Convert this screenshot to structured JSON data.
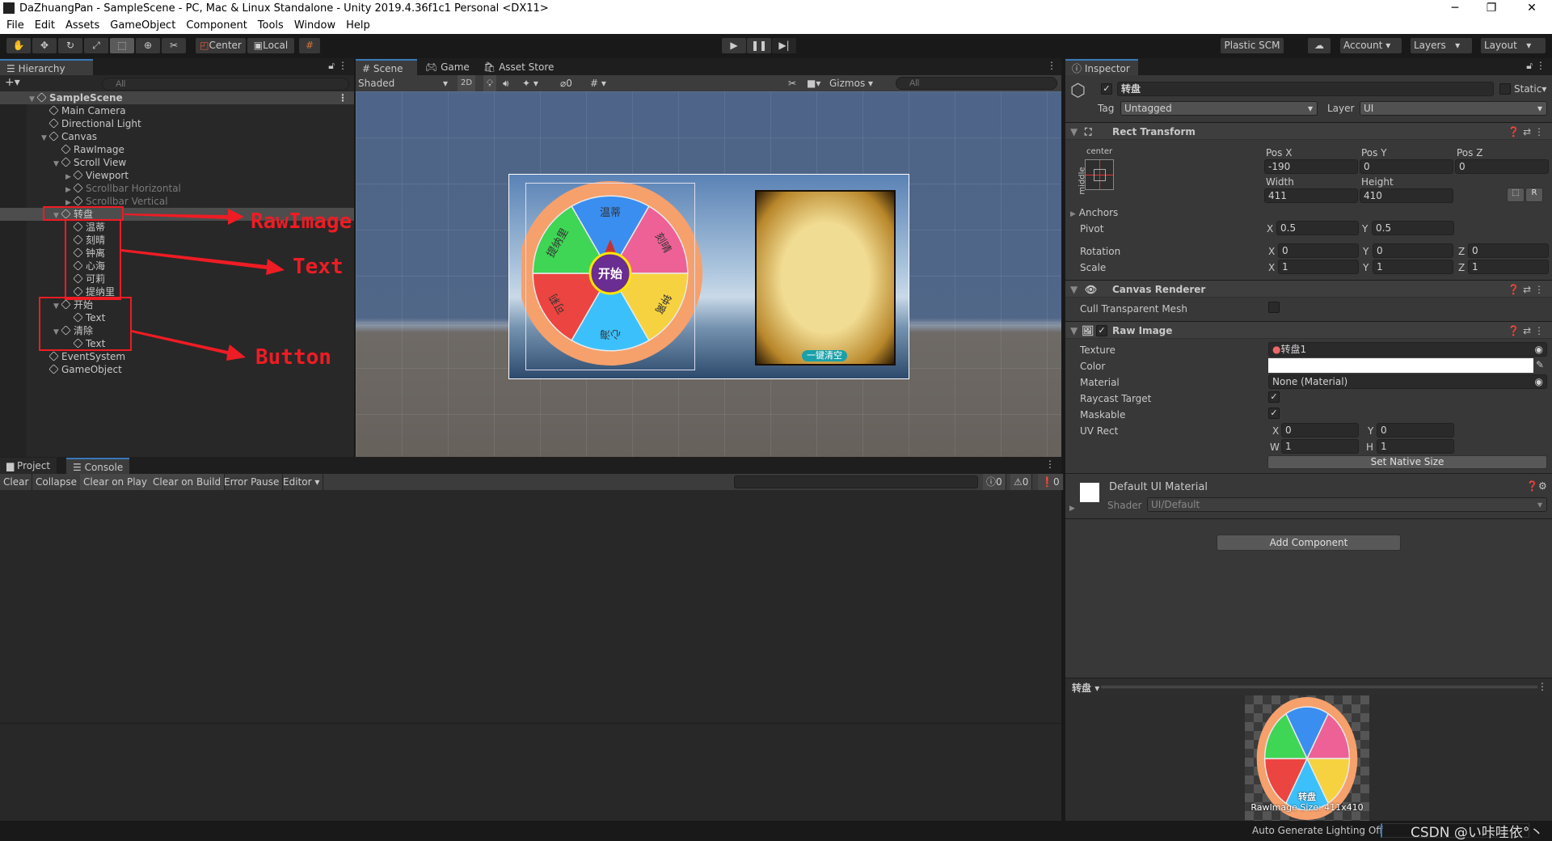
{
  "window": {
    "title": "DaZhuangPan - SampleScene - PC, Mac & Linux Standalone - Unity 2019.4.36f1c1 Personal <DX11>",
    "minimize": "─",
    "restore": "❐",
    "close": "✕"
  },
  "menu": [
    "File",
    "Edit",
    "Assets",
    "GameObject",
    "Component",
    "Tools",
    "Window",
    "Help"
  ],
  "toolbar": {
    "center": "Center",
    "local": "Local",
    "plastic": "Plastic SCM",
    "account": "Account",
    "layers": "Layers",
    "layout": "Layout"
  },
  "hierarchy": {
    "tab": "Hierarchy",
    "search_placeholder": "All",
    "add": "+▾",
    "items": [
      {
        "label": "SampleScene",
        "depth": 0,
        "arrow": "▼",
        "kind": "scene"
      },
      {
        "label": "Main Camera",
        "depth": 1,
        "arrow": ""
      },
      {
        "label": "Directional Light",
        "depth": 1,
        "arrow": ""
      },
      {
        "label": "Canvas",
        "depth": 1,
        "arrow": "▼"
      },
      {
        "label": "RawImage",
        "depth": 2,
        "arrow": ""
      },
      {
        "label": "Scroll View",
        "depth": 2,
        "arrow": "▼"
      },
      {
        "label": "Viewport",
        "depth": 3,
        "arrow": "▶"
      },
      {
        "label": "Scrollbar Horizontal",
        "depth": 3,
        "arrow": "▶",
        "dim": true
      },
      {
        "label": "Scrollbar Vertical",
        "depth": 3,
        "arrow": "▶",
        "dim": true
      },
      {
        "label": "转盘",
        "depth": 2,
        "arrow": "▼",
        "selected": true
      },
      {
        "label": "温蒂",
        "depth": 3,
        "arrow": ""
      },
      {
        "label": "刻晴",
        "depth": 3,
        "arrow": ""
      },
      {
        "label": "钟离",
        "depth": 3,
        "arrow": ""
      },
      {
        "label": "心海",
        "depth": 3,
        "arrow": ""
      },
      {
        "label": "可莉",
        "depth": 3,
        "arrow": ""
      },
      {
        "label": "提纳里",
        "depth": 3,
        "arrow": ""
      },
      {
        "label": "开始",
        "depth": 2,
        "arrow": "▼"
      },
      {
        "label": "Text",
        "depth": 3,
        "arrow": ""
      },
      {
        "label": "清除",
        "depth": 2,
        "arrow": "▼"
      },
      {
        "label": "Text",
        "depth": 3,
        "arrow": ""
      },
      {
        "label": "EventSystem",
        "depth": 1,
        "arrow": ""
      },
      {
        "label": "GameObject",
        "depth": 1,
        "arrow": ""
      }
    ]
  },
  "annotations": {
    "rawimage": "RawImage",
    "text": "Text",
    "button": "Button",
    "color": "#ee1c24"
  },
  "scene": {
    "tabs": [
      "# Scene",
      "Game",
      "Asset Store"
    ],
    "shading": "Shaded",
    "mode2d": "2D",
    "hidden_count": "0",
    "gizmos": "Gizmos",
    "search_placeholder": "All",
    "wheel": {
      "center_label": "开始",
      "slices": [
        {
          "label": "温蒂",
          "color": "#3a8ef0"
        },
        {
          "label": "刻晴",
          "color": "#ee6196"
        },
        {
          "label": "钟离",
          "color": "#f6d240"
        },
        {
          "label": "心海",
          "color": "#3cc0fb"
        },
        {
          "label": "可莉",
          "color": "#ec4440"
        },
        {
          "label": "提纳里",
          "color": "#3fd555"
        }
      ],
      "rim_color": "#f6a06c"
    },
    "clear_button": "一键清空"
  },
  "inspector": {
    "tab": "Inspector",
    "object_name": "转盘",
    "active": true,
    "static": "Static",
    "tag_label": "Tag",
    "tag": "Untagged",
    "layer_label": "Layer",
    "layer": "UI",
    "rect": {
      "title": "Rect Transform",
      "anchor_h": "center",
      "anchor_v": "middle",
      "posx_label": "Pos X",
      "posy_label": "Pos Y",
      "posz_label": "Pos Z",
      "posx": "-190",
      "posy": "0",
      "posz": "0",
      "width_label": "Width",
      "height_label": "Height",
      "width": "411",
      "height": "410",
      "r": "R",
      "anchors": "Anchors",
      "pivot": "Pivot",
      "pivot_x": "0.5",
      "pivot_y": "0.5",
      "rotation": "Rotation",
      "rot_x": "0",
      "rot_y": "0",
      "rot_z": "0",
      "scale": "Scale",
      "scale_x": "1",
      "scale_y": "1",
      "scale_z": "1"
    },
    "canvas_renderer": {
      "title": "Canvas Renderer",
      "cull": "Cull Transparent Mesh",
      "cull_checked": false
    },
    "raw_image": {
      "title": "Raw Image",
      "texture_label": "Texture",
      "texture": "转盘1",
      "color_label": "Color",
      "color": "#ffffff",
      "material_label": "Material",
      "material": "None (Material)",
      "raycast": "Raycast Target",
      "raycast_checked": true,
      "maskable": "Maskable",
      "maskable_checked": true,
      "uv_label": "UV Rect",
      "uv_x": "0",
      "uv_y": "0",
      "uv_w": "1",
      "uv_h": "1",
      "native": "Set Native Size"
    },
    "material": {
      "title": "Default UI Material",
      "shader_label": "Shader",
      "shader": "UI/Default"
    },
    "add_component": "Add Component",
    "preview": {
      "name": "转盘",
      "label": "转盘",
      "size": "RawImage Size: 411x410"
    }
  },
  "console": {
    "tabs": [
      "Project",
      "Console"
    ],
    "buttons": [
      "Clear",
      "Collapse",
      "Clear on Play",
      "Clear on Build",
      "Error Pause",
      "Editor ▾"
    ],
    "log_count": "0",
    "warn_count": "0",
    "error_count": "0"
  },
  "status": {
    "lighting": "Auto Generate Lighting Off",
    "watermark": "CSDN @い咔哇依°丶"
  }
}
